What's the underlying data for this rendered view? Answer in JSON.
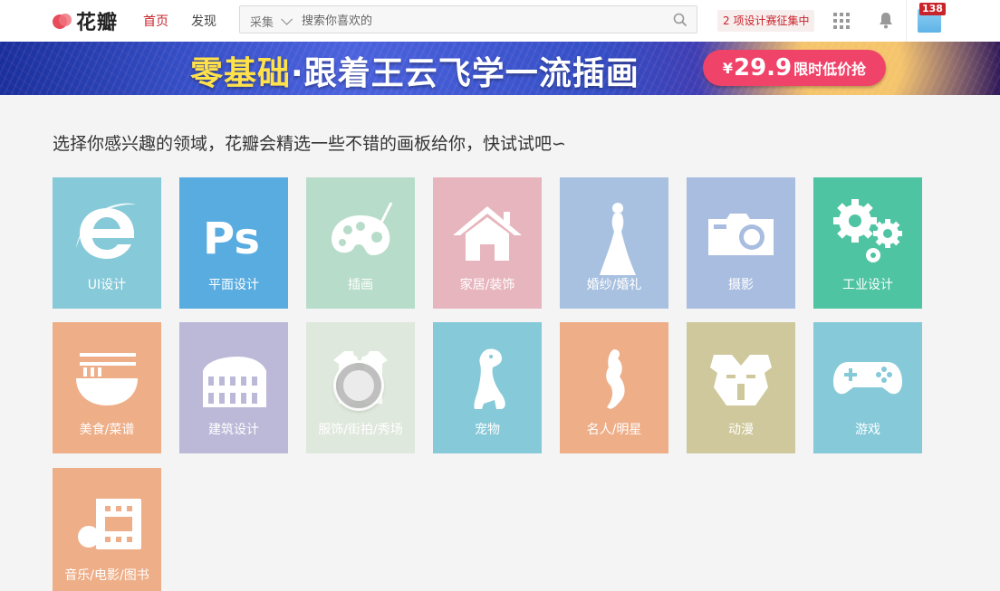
{
  "header": {
    "logo_text": "花瓣",
    "nav": [
      {
        "label": "首页",
        "active": true
      },
      {
        "label": "发现",
        "active": false
      }
    ],
    "search": {
      "category": "采集",
      "placeholder": "搜索你喜欢的"
    },
    "contest_label": "2 项设计赛征集中",
    "notification_count": "138"
  },
  "banner": {
    "title_highlight": "零基础",
    "title_rest": "·跟着王云飞学一流插画",
    "price_symbol": "¥",
    "price_value": "29.9",
    "price_note": "限时低价抢"
  },
  "intro_text": "选择你感兴趣的领域，花瓣会精选一些不错的画板给你，快试试吧∽",
  "categories": [
    {
      "label": "UI设计",
      "color": "#86c9d8",
      "icon": "ie-logo-icon"
    },
    {
      "label": "平面设计",
      "color": "#59ace0",
      "icon": "photoshop-icon"
    },
    {
      "label": "插画",
      "color": "#b8dcca",
      "icon": "palette-icon"
    },
    {
      "label": "家居/装饰",
      "color": "#e7b5bd",
      "icon": "house-icon"
    },
    {
      "label": "婚纱/婚礼",
      "color": "#a9c1e0",
      "icon": "bride-icon"
    },
    {
      "label": "摄影",
      "color": "#a9bde0",
      "icon": "camera-icon"
    },
    {
      "label": "工业设计",
      "color": "#4fc4a2",
      "icon": "gears-icon"
    },
    {
      "label": "美食/菜谱",
      "color": "#eeae88",
      "icon": "noodle-bowl-icon"
    },
    {
      "label": "建筑设计",
      "color": "#bcb8d8",
      "icon": "colosseum-icon"
    },
    {
      "label": "服饰/街拍/秀场",
      "color": "#dfe8dc",
      "icon": "clothing-icon"
    },
    {
      "label": "宠物",
      "color": "#86c9d8",
      "icon": "dog-icon"
    },
    {
      "label": "名人/明星",
      "color": "#eeae88",
      "icon": "dancer-icon"
    },
    {
      "label": "动漫",
      "color": "#cfc89c",
      "icon": "transformer-icon"
    },
    {
      "label": "游戏",
      "color": "#86c9d8",
      "icon": "gamepad-icon"
    },
    {
      "label": "音乐/电影/图书",
      "color": "#eeae88",
      "icon": "music-film-icon"
    }
  ]
}
